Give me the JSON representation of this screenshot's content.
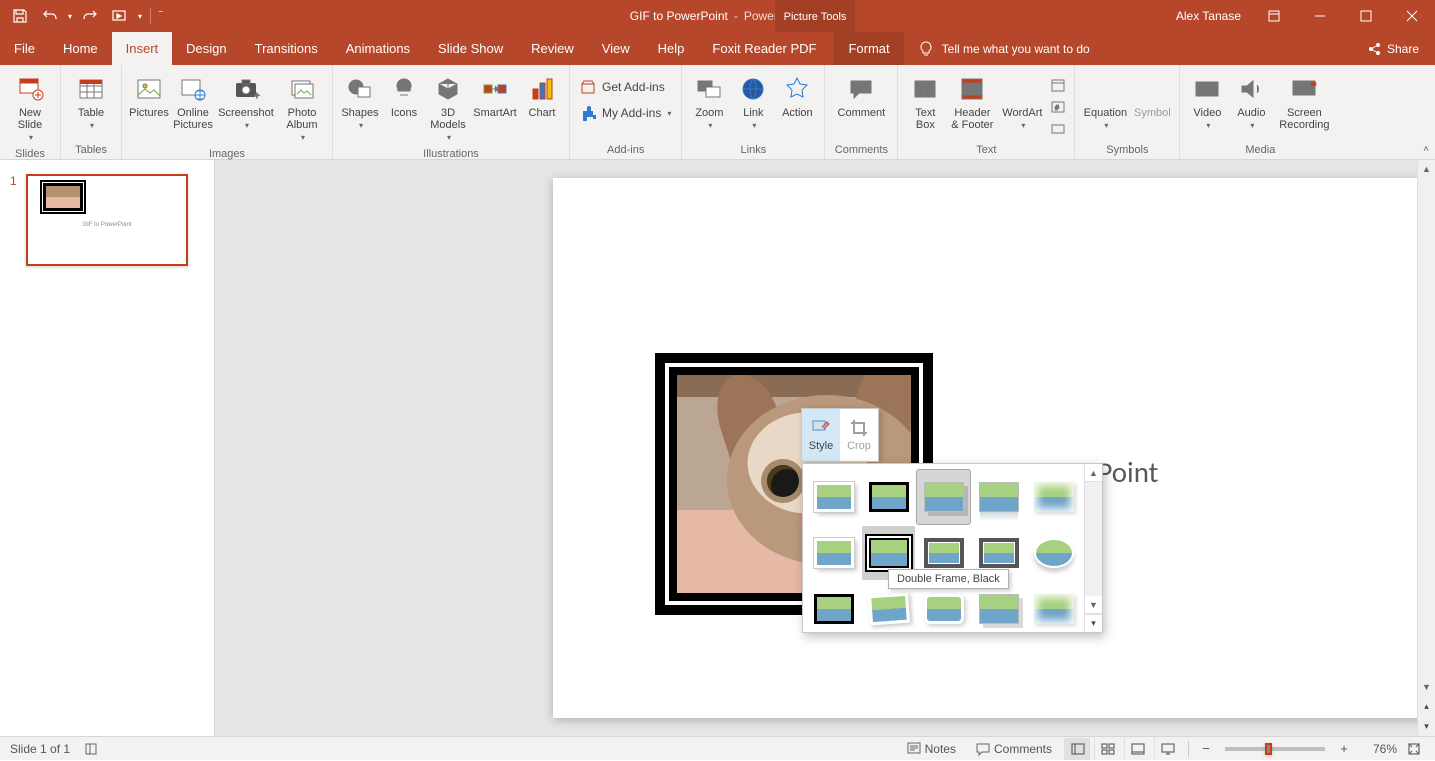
{
  "title": {
    "doc": "GIF to PowerPoint",
    "sep": "-",
    "app": "PowerPoint"
  },
  "contextual_tab": "Picture Tools",
  "user": "Alex Tanase",
  "tabs": [
    "File",
    "Home",
    "Insert",
    "Design",
    "Transitions",
    "Animations",
    "Slide Show",
    "Review",
    "View",
    "Help",
    "Foxit Reader PDF",
    "Format"
  ],
  "active_tab": "Insert",
  "tellme": "Tell me what you want to do",
  "share": "Share",
  "ribbon": {
    "groups": {
      "slides": {
        "label": "Slides",
        "new_slide": "New\nSlide"
      },
      "tables": {
        "label": "Tables",
        "table": "Table"
      },
      "images": {
        "label": "Images",
        "pictures": "Pictures",
        "online_pictures": "Online\nPictures",
        "screenshot": "Screenshot",
        "photo_album": "Photo\nAlbum"
      },
      "illus": {
        "label": "Illustrations",
        "shapes": "Shapes",
        "icons": "Icons",
        "models": "3D\nModels",
        "smartart": "SmartArt",
        "chart": "Chart"
      },
      "addins": {
        "label": "Add-ins",
        "get": "Get Add-ins",
        "my": "My Add-ins"
      },
      "links": {
        "label": "Links",
        "zoom": "Zoom",
        "link": "Link",
        "action": "Action"
      },
      "comments": {
        "label": "Comments",
        "comment": "Comment"
      },
      "text": {
        "label": "Text",
        "text_box": "Text\nBox",
        "header_footer": "Header\n& Footer",
        "wordart": "WordArt"
      },
      "symbols": {
        "label": "Symbols",
        "equation": "Equation",
        "symbol": "Symbol"
      },
      "media": {
        "label": "Media",
        "video": "Video",
        "audio": "Audio",
        "screen_rec": "Screen\nRecording"
      }
    }
  },
  "thumb": {
    "number": "1",
    "caption": "GIF to PowerPoint"
  },
  "slide": {
    "title": "GIF to PowerPoint"
  },
  "mini_toolbar": {
    "style": "Style",
    "crop": "Crop"
  },
  "style_gallery": {
    "tooltip": "Double Frame, Black",
    "items": [
      {
        "name": "simple-frame-white",
        "cls": "frame-w"
      },
      {
        "name": "simple-frame-black",
        "cls": "frame-b"
      },
      {
        "name": "drop-shadow-rect",
        "cls": "shadow",
        "sel": true
      },
      {
        "name": "reflected-rect",
        "cls": "refl"
      },
      {
        "name": "soft-edge-rect",
        "cls": "soft"
      },
      {
        "name": "compound-frame",
        "cls": "frame-w"
      },
      {
        "name": "double-frame-black",
        "cls": "dbl-black",
        "hover": true
      },
      {
        "name": "thick-matte-black",
        "cls": "metal"
      },
      {
        "name": "metal-frame",
        "cls": "metal"
      },
      {
        "name": "beveled-oval",
        "cls": "oval"
      },
      {
        "name": "moderate-frame-black",
        "cls": "frame-b"
      },
      {
        "name": "rotated-white",
        "cls": "tilt"
      },
      {
        "name": "rounded-white",
        "cls": "roundwhite"
      },
      {
        "name": "perspective-shadow",
        "cls": "shadow"
      },
      {
        "name": "relaxed-perspective",
        "cls": "soft"
      }
    ]
  },
  "status": {
    "slide_info": "Slide 1 of 1",
    "notes": "Notes",
    "comments": "Comments",
    "zoom": "76%"
  }
}
